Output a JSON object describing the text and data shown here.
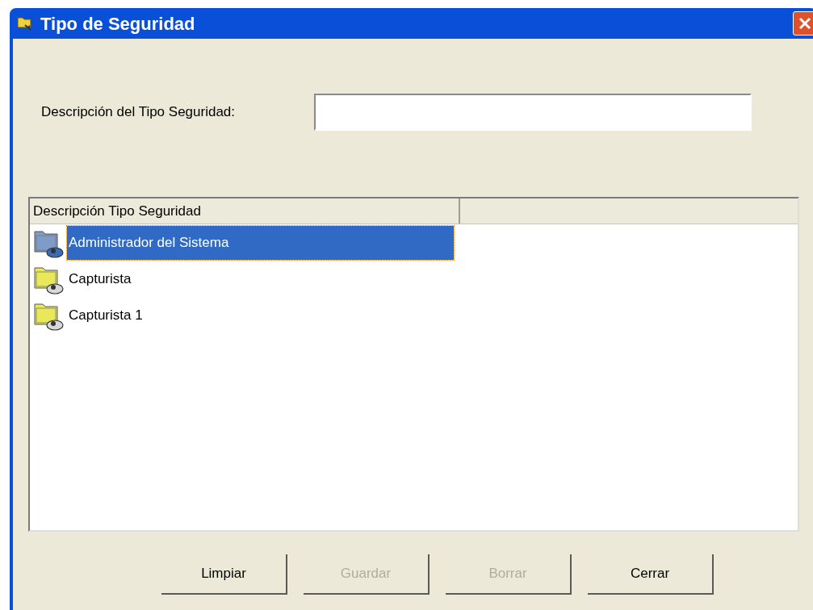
{
  "window": {
    "title": "Tipo de Seguridad"
  },
  "description_field": {
    "label": "Descripción del Tipo Seguridad:"
  },
  "list": {
    "columns": [
      "Descripción Tipo Seguridad"
    ],
    "rows": [
      {
        "label": "Administrador del Sistema",
        "kind": "admin",
        "selected": true
      },
      {
        "label": "Capturista",
        "kind": "user",
        "selected": false
      },
      {
        "label": "Capturista 1",
        "kind": "user",
        "selected": false
      }
    ]
  },
  "buttons": [
    {
      "label": "Limpiar",
      "disabled": false
    },
    {
      "label": "Guardar",
      "disabled": true
    },
    {
      "label": "Borrar",
      "disabled": true
    },
    {
      "label": "Cerrar",
      "disabled": false
    }
  ]
}
